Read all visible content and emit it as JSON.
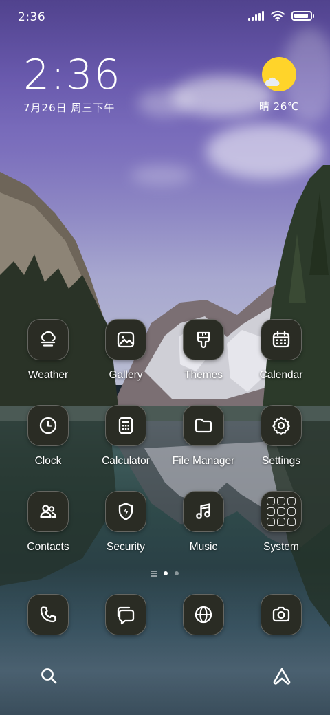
{
  "status_bar": {
    "time": "2:36",
    "signal_icon": "cellular-signal-icon",
    "wifi_icon": "wifi-icon",
    "battery_icon": "battery-icon",
    "battery_level": 0.9
  },
  "clock_widget": {
    "time": "2:36",
    "date": "7月26日 周三下午"
  },
  "weather_widget": {
    "icon": "partly-sunny-icon",
    "text": "晴 26℃"
  },
  "apps": [
    {
      "label": "Weather",
      "icon": "weather-cloud-icon"
    },
    {
      "label": "Gallery",
      "icon": "gallery-image-icon"
    },
    {
      "label": "Themes",
      "icon": "paintbrush-icon"
    },
    {
      "label": "Calendar",
      "icon": "calendar-icon"
    },
    {
      "label": "Clock",
      "icon": "clock-icon"
    },
    {
      "label": "Calculator",
      "icon": "calculator-icon"
    },
    {
      "label": "File Manager",
      "icon": "folder-icon"
    },
    {
      "label": "Settings",
      "icon": "gear-icon"
    },
    {
      "label": "Contacts",
      "icon": "contacts-icon"
    },
    {
      "label": "Security",
      "icon": "shield-bolt-icon"
    },
    {
      "label": "Music",
      "icon": "music-note-icon"
    },
    {
      "label": "System",
      "icon": "folder-apps-icon"
    }
  ],
  "page_indicator": {
    "pages": 2,
    "active": 0
  },
  "dock": [
    {
      "icon": "phone-icon"
    },
    {
      "icon": "messages-icon"
    },
    {
      "icon": "browser-globe-icon"
    },
    {
      "icon": "camera-icon"
    }
  ],
  "bottom_bar": {
    "search_icon": "search-icon",
    "assistant_icon": "assistant-icon"
  },
  "colors": {
    "icon_background": "#2a2c24",
    "sun": "#ffd42a",
    "text": "#ffffff"
  }
}
